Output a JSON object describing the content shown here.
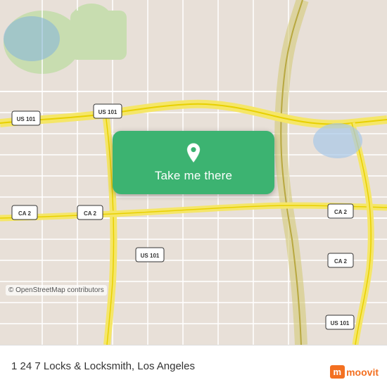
{
  "map": {
    "copyright": "© OpenStreetMap contributors",
    "background_color": "#e8e0d8"
  },
  "button": {
    "label": "Take me there",
    "pin_icon": "location-pin"
  },
  "info_bar": {
    "place": "1 24 7 Locks & Locksmith, Los Angeles"
  },
  "moovit": {
    "letter": "m",
    "text": "moovit"
  },
  "road_labels": [
    {
      "id": "US 101 top-right",
      "label": "US 101"
    },
    {
      "id": "CA 2 bottom-left",
      "label": "CA 2"
    },
    {
      "id": "US 101 mid-left",
      "label": "US 101"
    },
    {
      "id": "CA 2 mid",
      "label": "CA 2"
    },
    {
      "id": "US 101 bottom-mid",
      "label": "US 101"
    },
    {
      "id": "CA 2 bottom-right",
      "label": "CA 2"
    },
    {
      "id": "US 101 bottom-right",
      "label": "US 101"
    }
  ]
}
